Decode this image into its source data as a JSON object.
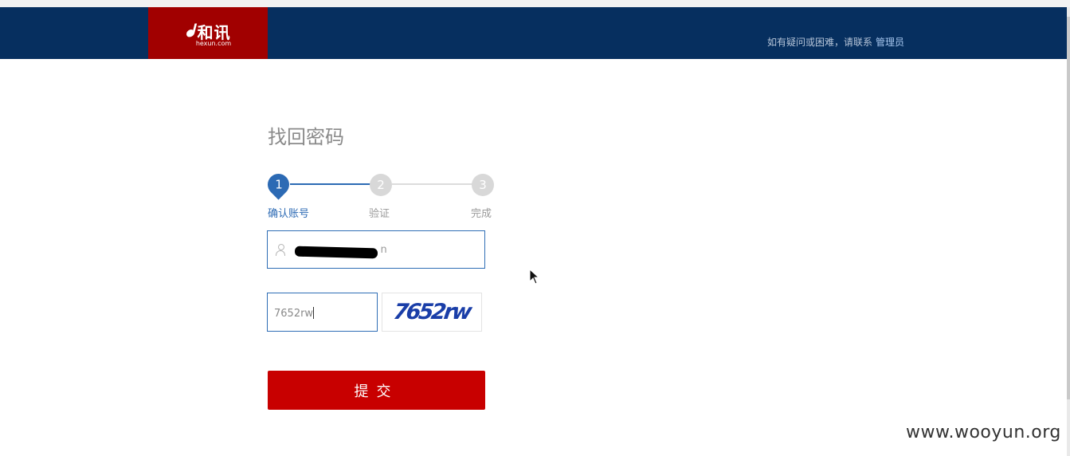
{
  "brand": {
    "logo_text": "和讯",
    "logo_domain": "hexun.com",
    "header_color": "#062f5f",
    "logo_bg": "#a10000"
  },
  "help": {
    "text": "如有疑问或困难，请联系",
    "link": "管理员"
  },
  "page": {
    "title": "找回密码"
  },
  "steps": {
    "accent": "#2c6ab4",
    "items": [
      {
        "num": "1",
        "label": "确认账号",
        "state": "active"
      },
      {
        "num": "2",
        "label": "验证",
        "state": "pending"
      },
      {
        "num": "3",
        "label": "完成",
        "state": "pending"
      }
    ]
  },
  "form": {
    "account_visible_suffix": "n",
    "captcha_value": "7652rw",
    "captcha_image_text": "7652rw",
    "submit_label": "提交",
    "submit_color": "#c80000"
  },
  "watermark": "www.wooyun.org"
}
